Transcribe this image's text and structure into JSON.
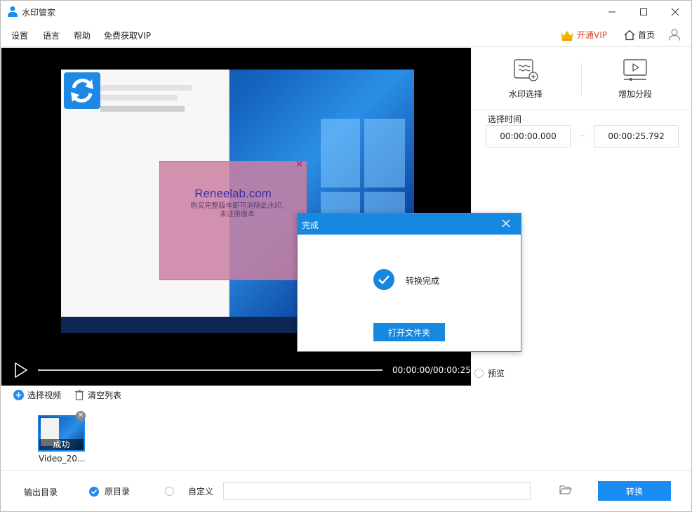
{
  "window": {
    "title": "水印管家"
  },
  "menu": {
    "settings": "设置",
    "language": "语言",
    "help": "帮助",
    "free_vip": "免费获取VIP",
    "vip": "开通VIP",
    "home": "首页"
  },
  "player": {
    "time": "00:00:00/00:00:25"
  },
  "watermark": {
    "site": "Reneelab.com",
    "line1": "购买完整版本即可消除此水印,",
    "line2": "未注册版本"
  },
  "tools": {
    "watermark_select": "水印选择",
    "add_segment": "增加分段"
  },
  "time_range": {
    "label": "选择时间",
    "start": "00:00:00.000",
    "end": "00:00:25.792"
  },
  "preview": {
    "label": "预览"
  },
  "file_list": {
    "select_video": "选择视频",
    "clear_list": "清空列表"
  },
  "file_item": {
    "status": "成功",
    "name": "Video_20..."
  },
  "output": {
    "label": "输出目录",
    "original_dir": "原目录",
    "custom": "自定义",
    "path_value": ""
  },
  "actions": {
    "convert": "转换"
  },
  "dialog": {
    "title": "完成",
    "message": "转换完成",
    "open_folder": "打开文件夹"
  },
  "colors": {
    "accent": "#1a8bf0",
    "vip": "#e0442b"
  }
}
